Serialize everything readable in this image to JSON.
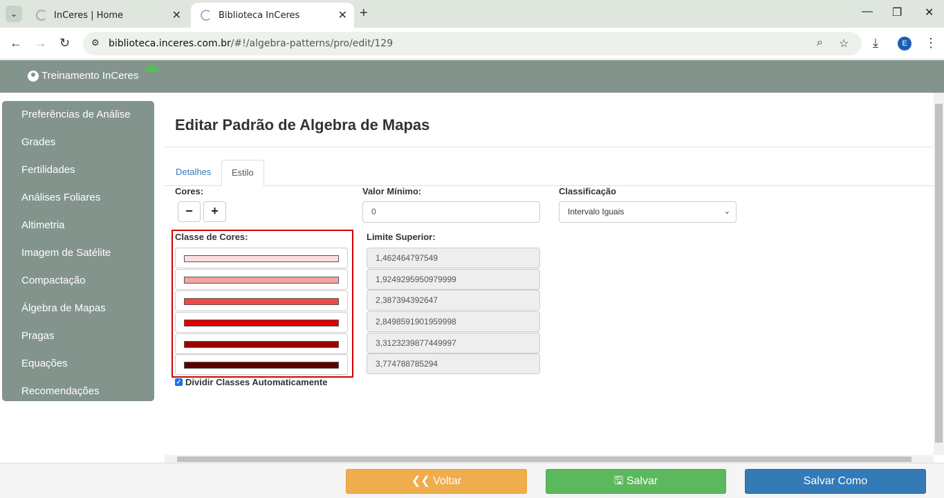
{
  "browser": {
    "tabs": [
      {
        "title": "InCeres | Home"
      },
      {
        "title": "Biblioteca InCeres"
      }
    ],
    "url_host": "biblioteca.inceres.com.br",
    "url_path": "/#!/algebra-patterns/pro/edit/129",
    "profile_initial": "E"
  },
  "header": {
    "user": "Treinamento InCeres"
  },
  "sidebar": {
    "items": [
      {
        "label": "Preferências de Análise"
      },
      {
        "label": "Grades"
      },
      {
        "label": "Fertilidades"
      },
      {
        "label": "Análises Foliares"
      },
      {
        "label": "Altimetria"
      },
      {
        "label": "Imagem de Satélite"
      },
      {
        "label": "Compactação"
      },
      {
        "label": "Álgebra de Mapas"
      },
      {
        "label": "Pragas"
      },
      {
        "label": "Equações"
      },
      {
        "label": "Recomendações"
      }
    ]
  },
  "main": {
    "title": "Editar Padrão de Algebra de Mapas",
    "tabs": [
      {
        "label": "Detalhes"
      },
      {
        "label": "Estilo"
      }
    ],
    "cores_label": "Cores:",
    "minus": "−",
    "plus": "+",
    "valor_minimo_label": "Valor Mínimo:",
    "valor_minimo": "0",
    "classificacao_label": "Classificação",
    "classificacao": "Intervalo Iguais",
    "classe_cores_label": "Classe de Cores:",
    "limite_superior_label": "Limite Superior:",
    "colors": [
      "#fddede",
      "#f5a3a3",
      "#f04848",
      "#dd0000",
      "#9a0000",
      "#5e0000"
    ],
    "limits": [
      "1,462464797549",
      "1,9249295950979999",
      "2,387394392647",
      "2,8498591901959998",
      "3,3123239877449997",
      "3,774788785294"
    ],
    "checkbox_label": "Dividir Classes Automaticamente"
  },
  "footer": {
    "voltar": "Voltar",
    "salvar": "Salvar",
    "salvar_como": "Salvar Como"
  }
}
